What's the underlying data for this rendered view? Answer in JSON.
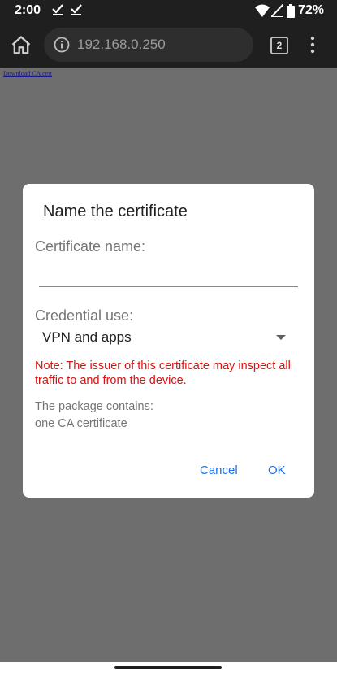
{
  "status_bar": {
    "time": "2:00",
    "battery": "72%"
  },
  "browser": {
    "url": "192.168.0.250",
    "tab_count": "2"
  },
  "page": {
    "link_text": "Download CA cert"
  },
  "dialog": {
    "title": "Name the certificate",
    "cert_name_label": "Certificate name:",
    "cert_name_value": "",
    "credential_label": "Credential use:",
    "credential_value": "VPN and apps",
    "note": "Note: The issuer of this certificate may inspect all traffic to and from the device.",
    "package_label": "The package contains:",
    "package_items": [
      "one CA certificate"
    ],
    "cancel_label": "Cancel",
    "ok_label": "OK"
  },
  "colors": {
    "accent": "#1a73e8",
    "warning": "#e01010",
    "scrim": "#6e6e6e",
    "chrome_dark": "#1f1f1f"
  },
  "icons": [
    "check-icon",
    "check-icon",
    "wifi-icon",
    "signal-icon",
    "battery-icon",
    "home-icon",
    "info-icon",
    "tabs-icon",
    "more-vert-icon",
    "dropdown-arrow-icon"
  ]
}
